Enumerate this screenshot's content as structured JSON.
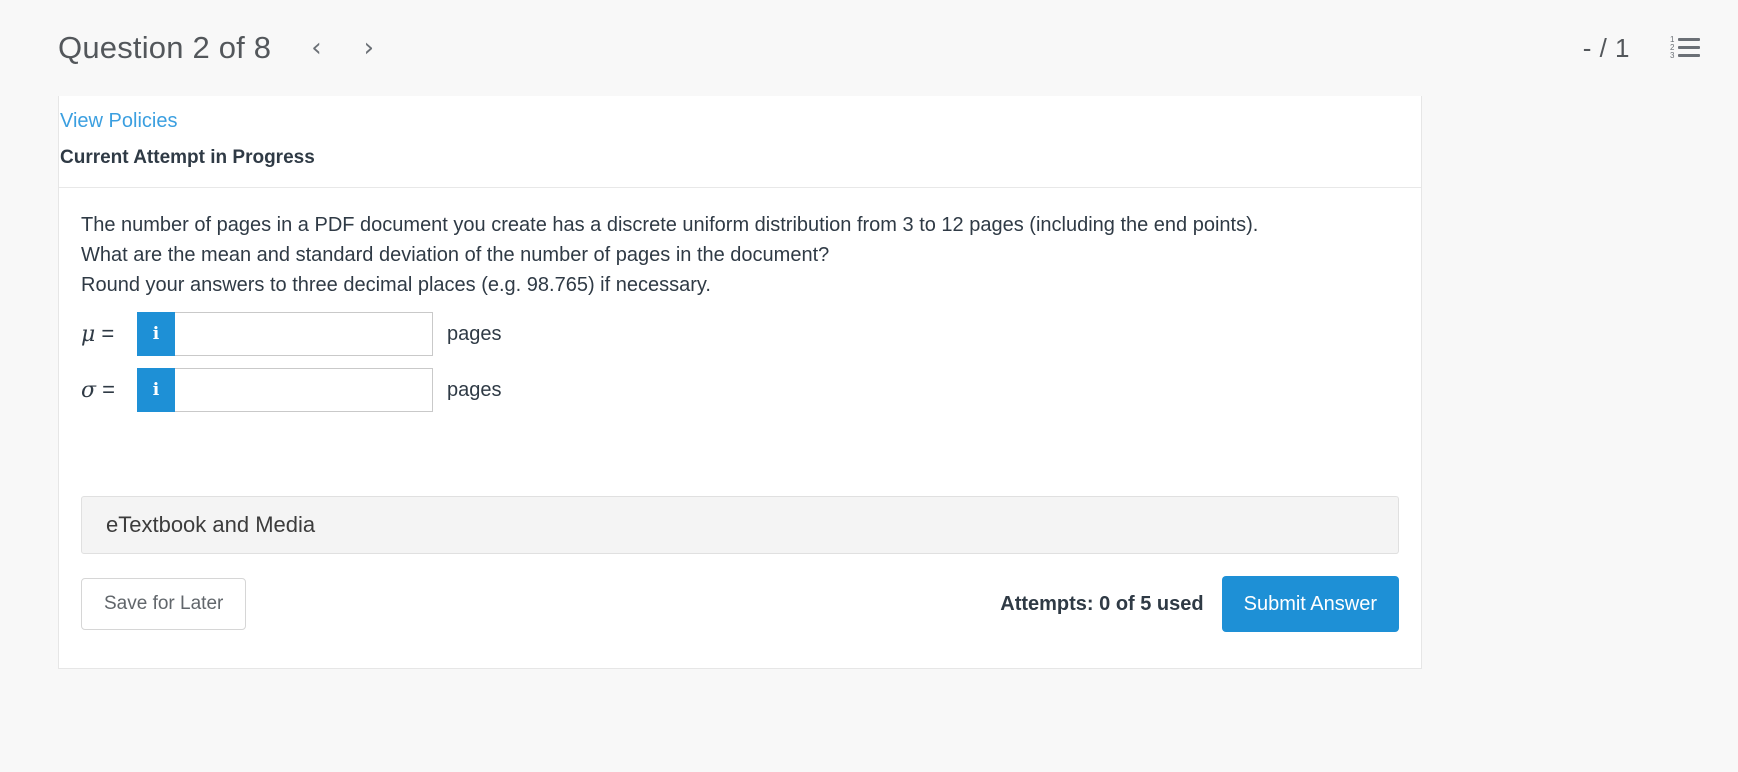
{
  "header": {
    "question_title": "Question 2 of 8",
    "prev_arrow": "‹",
    "next_arrow": "›",
    "score": "- / 1",
    "list_icon_numbers": [
      "1",
      "2",
      "3"
    ]
  },
  "card": {
    "policies_link": "View Policies",
    "attempt_status": "Current Attempt in Progress",
    "question_text": "The number of pages in a PDF document you create has a discrete uniform distribution from 3 to 12 pages (including the end points). What are the mean and standard deviation of the number of pages in the document? Round your answers to three decimal places (e.g. 98.765) if necessary.",
    "question_lines": [
      "The number of pages in a PDF document you create has a discrete uniform distribution from 3 to 12 pages (including the end points).",
      "What are the mean and standard deviation of the number of pages in the document?",
      "Round your answers to three decimal places (e.g. 98.765) if necessary."
    ],
    "answers": [
      {
        "symbol": "μ",
        "equals": " =",
        "info_label": "i",
        "value": "",
        "placeholder": "",
        "unit": "pages"
      },
      {
        "symbol": "σ",
        "equals": " =",
        "info_label": "i",
        "value": "",
        "placeholder": "",
        "unit": "pages"
      }
    ],
    "etextbook_label": "eTextbook and Media",
    "save_label": "Save for Later",
    "attempts_text": "Attempts: 0 of 5 used",
    "submit_label": "Submit Answer"
  },
  "colors": {
    "accent_blue": "#1e90d6",
    "link_blue": "#3b9fe0",
    "page_background": "#f8f8f8",
    "card_background": "#ffffff",
    "text": "#2f3a45"
  }
}
